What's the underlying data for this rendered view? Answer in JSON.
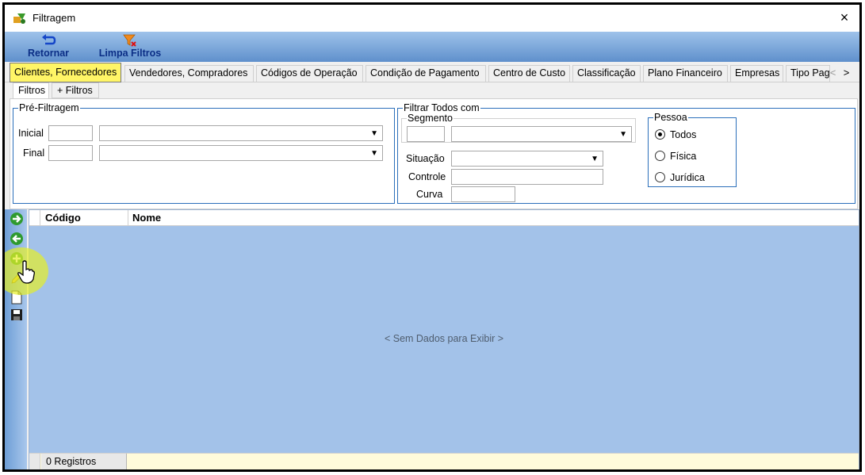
{
  "window": {
    "title": "Filtragem",
    "close_glyph": "×"
  },
  "toolbar": {
    "retornar": {
      "label": "Retornar",
      "icon": "return-arrow-icon"
    },
    "limpa_filtros": {
      "label": "Limpa Filtros",
      "icon": "funnel-clear-icon"
    }
  },
  "tabs": [
    {
      "label": "Clientes, Fornecedores",
      "active": true
    },
    {
      "label": "Vendedores, Compradores"
    },
    {
      "label": "Códigos de Operação"
    },
    {
      "label": "Condição de Pagamento"
    },
    {
      "label": "Centro de Custo"
    },
    {
      "label": "Classificação"
    },
    {
      "label": "Plano Financeiro"
    },
    {
      "label": "Empresas"
    },
    {
      "label": "Tipo Pag"
    }
  ],
  "tab_scroll": {
    "left": "<",
    "right": ">"
  },
  "subtabs": [
    {
      "label": "Filtros",
      "active": true
    },
    {
      "label": "+ Filtros"
    }
  ],
  "prefiltragem": {
    "title": "Pré-Filtragem",
    "inicial_label": "Inicial",
    "final_label": "Final"
  },
  "filtrar_todos": {
    "title": "Filtrar Todos com",
    "segmento_label": "Segmento",
    "situacao_label": "Situação",
    "controle_label": "Controle",
    "curva_label": "Curva"
  },
  "pessoa": {
    "title": "Pessoa",
    "options": [
      {
        "label": "Todos",
        "selected": true
      },
      {
        "label": "Física"
      },
      {
        "label": "Jurídica"
      }
    ]
  },
  "grid": {
    "columns": [
      "Código",
      "Nome"
    ],
    "empty_message": "< Sem Dados para Exibir >",
    "record_count": "0 Registros"
  },
  "colors": {
    "ribbon": "#6b98d2",
    "active_tab": "#fff566",
    "grid_bg": "#a3c2e9",
    "group_border": "#2b6fba"
  }
}
